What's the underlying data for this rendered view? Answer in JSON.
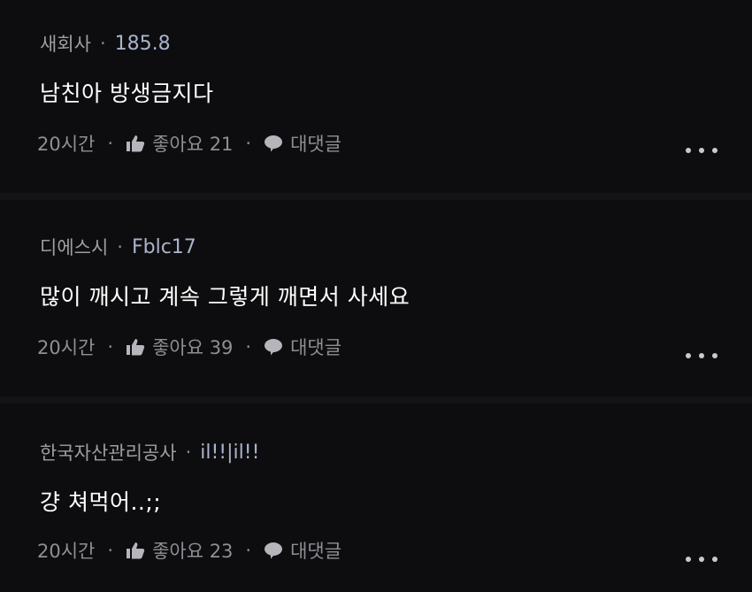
{
  "comments": [
    {
      "author": "새회사",
      "nickname": "185.8",
      "text": "남친아 방생금지다",
      "time": "20시간",
      "like_label": "좋아요 21",
      "reply_label": "대댓글"
    },
    {
      "author": "디에스시",
      "nickname": "Fblc17",
      "text": "많이 깨시고 계속 그렇게 깨면서 사세요",
      "time": "20시간",
      "like_label": "좋아요 39",
      "reply_label": "대댓글"
    },
    {
      "author": "한국자산관리공사",
      "nickname": "il!!|il!!",
      "text": "걍 쳐먹어..;;",
      "time": "20시간",
      "like_label": "좋아요 23",
      "reply_label": "대댓글"
    }
  ],
  "separator": "·",
  "icons": {
    "like": "thumbs-up-icon",
    "reply": "speech-bubble-icon",
    "more": "more-dots-icon"
  },
  "colors": {
    "background": "#0d0d0f",
    "text": "#ffffff",
    "meta": "#9d9da3",
    "nickname": "#a9b3cc"
  }
}
